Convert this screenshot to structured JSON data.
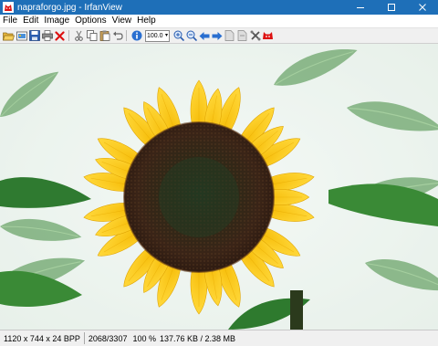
{
  "window": {
    "title": "napraforgo.jpg - IrfanView",
    "app_icon": "irfanview-red-cat-icon",
    "controls": [
      "minimize-icon",
      "maximize-icon",
      "close-icon"
    ]
  },
  "menu": {
    "items": [
      {
        "label": "File"
      },
      {
        "label": "Edit"
      },
      {
        "label": "Image"
      },
      {
        "label": "Options"
      },
      {
        "label": "View"
      },
      {
        "label": "Help"
      }
    ]
  },
  "toolbar": {
    "zoom_value": "100.0",
    "buttons": [
      "open-folder-icon",
      "slideshow-icon",
      "save-icon",
      "print-icon",
      "delete-icon",
      "cut-icon",
      "copy-icon",
      "paste-icon",
      "undo-icon",
      "info-icon",
      "zoom-in-icon",
      "zoom-out-icon",
      "previous-icon",
      "next-icon",
      "first-page-icon",
      "last-page-icon",
      "settings-icon",
      "exit-icon"
    ]
  },
  "image": {
    "subject": "sunflower",
    "petal_color": "#f7c613",
    "center_color": "#3a2417",
    "leaf_color": "#3e8a3a",
    "background_color": "#eef4f0"
  },
  "status": {
    "dimensions": "1120 x 744 x 24 BPP",
    "index": "2068/3307",
    "zoom": "100 %",
    "sizes": "137.76 KB / 2.38 MB"
  }
}
